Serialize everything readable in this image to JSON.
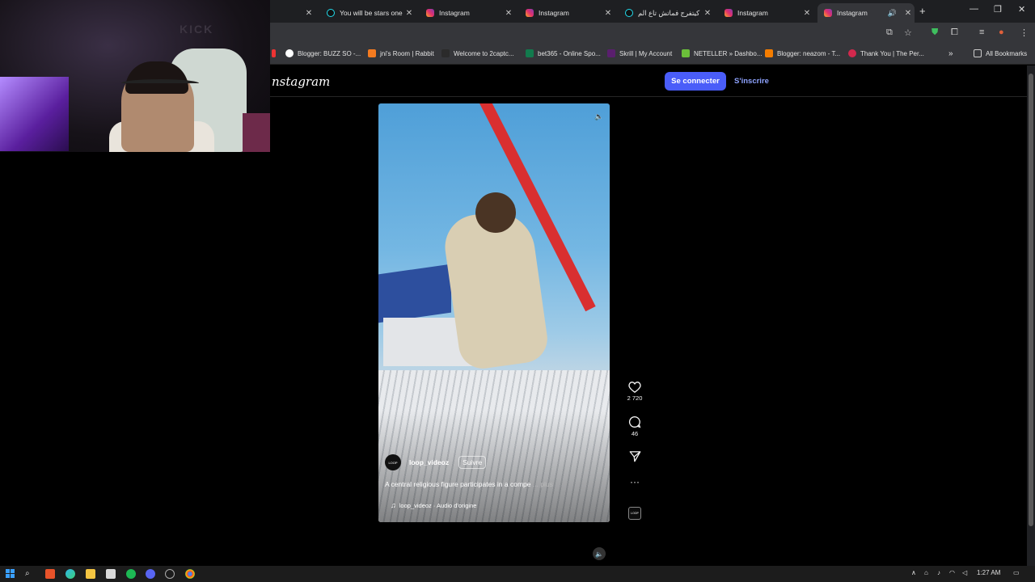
{
  "browser": {
    "tabs": [
      {
        "title": "You will be stars one",
        "icon": "tiktok-icon"
      },
      {
        "title": "Instagram",
        "icon": "instagram-icon"
      },
      {
        "title": "Instagram",
        "icon": "instagram-icon"
      },
      {
        "title": "كيتفرج فماتش تاع الم",
        "icon": "tiktok-icon"
      },
      {
        "title": "Instagram",
        "icon": "instagram-icon"
      },
      {
        "title": "Instagram",
        "icon": "instagram-icon",
        "active": true
      }
    ],
    "bookmarks": [
      {
        "label": "Blogger: BUZZ SO -...",
        "icon": "google-icon"
      },
      {
        "label": "jni's Room | Rabbit",
        "icon": "rabbit-icon"
      },
      {
        "label": "Welcome to 2captc...",
        "icon": "captcha-icon"
      },
      {
        "label": "bet365 - Online Spo...",
        "icon": "bet365-icon"
      },
      {
        "label": "Skrill | My Account",
        "icon": "skrill-icon"
      },
      {
        "label": "NETELLER » Dashbo...",
        "icon": "neteller-icon"
      },
      {
        "label": "Blogger: neazom - T...",
        "icon": "blogger-icon"
      },
      {
        "label": "Thank You | The Per...",
        "icon": "heart-icon"
      }
    ],
    "all_bookmarks": "All Bookmarks"
  },
  "instagram": {
    "logo_text": "nstagram",
    "login_label": "Se connecter",
    "signup_label": "S'inscrire",
    "reel": {
      "username": "loop_videoz",
      "follow_label": "Suivre",
      "avatar_text": "LOOP",
      "caption": "A central religious figure participates in a compe",
      "caption_more": "... plus",
      "audio": "loop_videoz · Audio d'origine",
      "likes": "2 720",
      "comments": "46"
    }
  },
  "webcam": {
    "logo_text": "KICK"
  },
  "taskbar": {
    "time": "1:27 AM"
  },
  "colors": {
    "accent": "#4a5df9",
    "link": "#8ea3ff",
    "page_bg": "#000000"
  }
}
